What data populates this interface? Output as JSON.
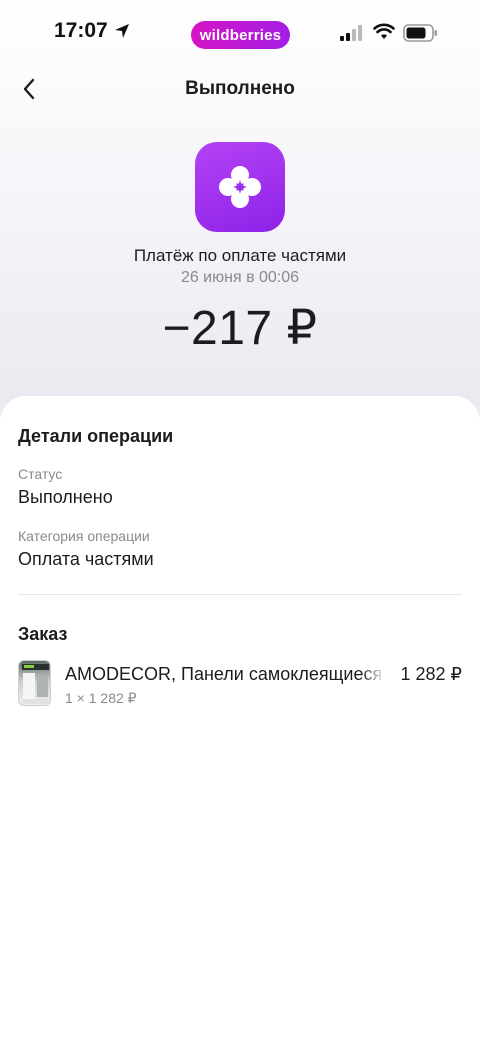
{
  "status_bar": {
    "time": "17:07",
    "brand": "wildberries"
  },
  "nav": {
    "title": "Выполнено"
  },
  "hero": {
    "payment_title": "Платёж по оплате частями",
    "date": "26 июня в 00:06",
    "amount": "−217 ₽"
  },
  "details": {
    "title": "Детали операции",
    "status_label": "Статус",
    "status_value": "Выполнено",
    "category_label": "Категория операции",
    "category_value": "Оплата частями"
  },
  "order": {
    "title": "Заказ",
    "item": {
      "name": "AMODECOR, Панели самоклеящиеся",
      "price": "1 282 ₽",
      "quantity": "1 × 1 282 ₽"
    }
  },
  "colors": {
    "brand_gradient_start": "#d514c4",
    "brand_gradient_end": "#a51ee6",
    "icon_purple": "#9b2ff0",
    "text_primary": "#1c1c1e",
    "text_secondary": "#8a8a8e"
  }
}
